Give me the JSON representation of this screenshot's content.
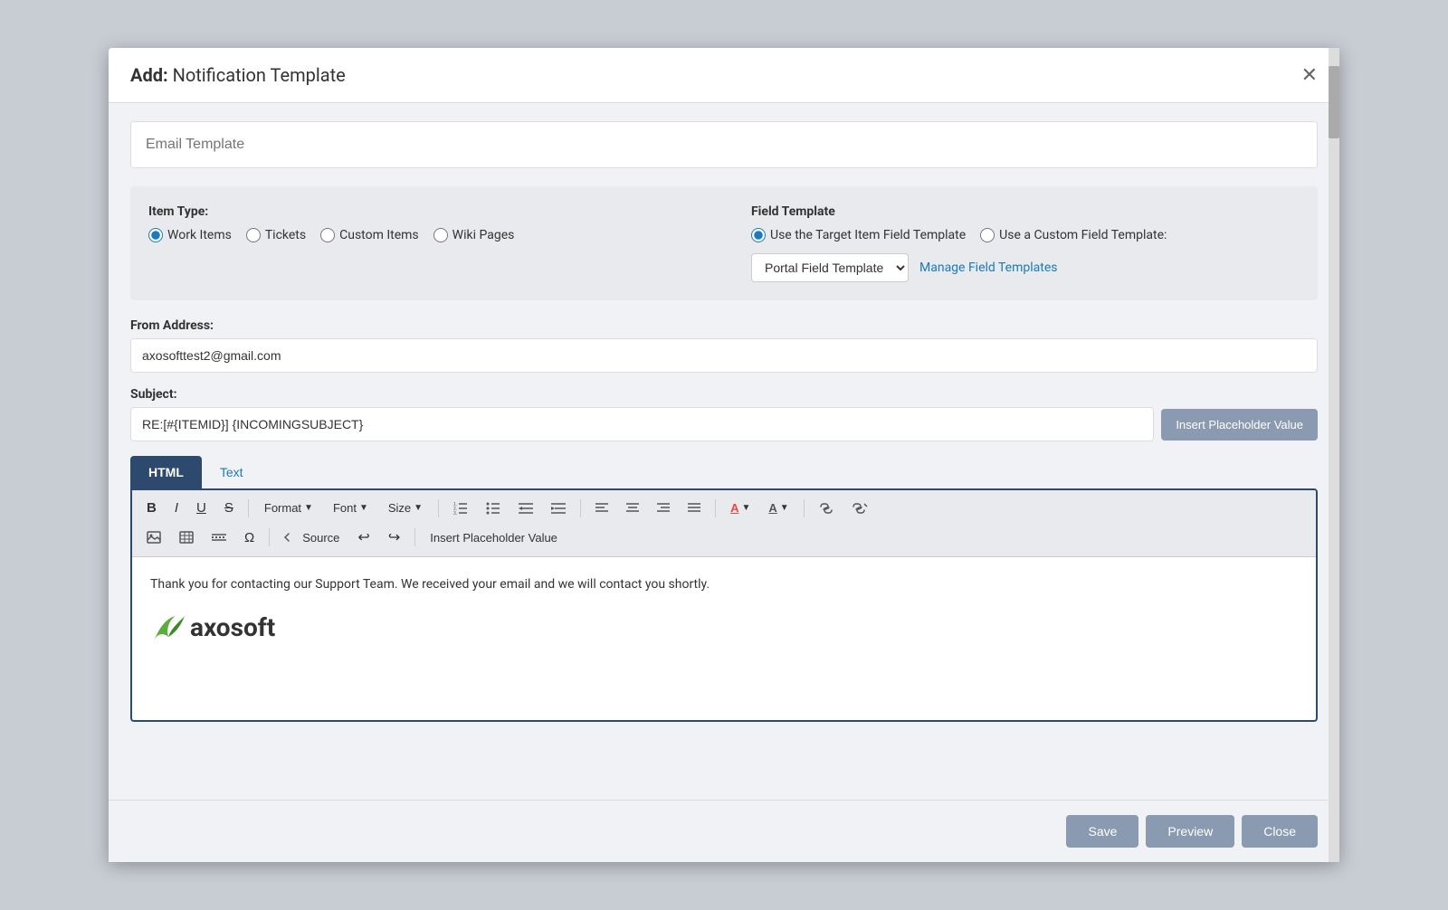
{
  "modal": {
    "title_prefix": "Add:",
    "title": "Notification Template",
    "close_icon": "✕"
  },
  "email_template": {
    "placeholder": "Email Template"
  },
  "item_type": {
    "label": "Item Type:",
    "options": [
      {
        "id": "work-items",
        "label": "Work Items",
        "checked": true
      },
      {
        "id": "tickets",
        "label": "Tickets",
        "checked": false
      },
      {
        "id": "custom-items",
        "label": "Custom Items",
        "checked": false
      },
      {
        "id": "wiki-pages",
        "label": "Wiki Pages",
        "checked": false
      }
    ]
  },
  "field_template": {
    "label": "Field Template",
    "options": [
      {
        "id": "use-target",
        "label": "Use the Target Item Field Template",
        "checked": true
      },
      {
        "id": "use-custom",
        "label": "Use a Custom Field Template:",
        "checked": false
      }
    ],
    "dropdown_value": "Portal Field Template",
    "manage_link": "Manage Field Templates"
  },
  "from_address": {
    "label": "From Address:",
    "value": "axosofttest2@gmail.com"
  },
  "subject": {
    "label": "Subject:",
    "value": "RE:[#{ITEMID}] {INCOMINGSUBJECT}",
    "insert_btn": "Insert Placeholder Value"
  },
  "editor": {
    "tabs": [
      {
        "id": "html",
        "label": "HTML",
        "active": true
      },
      {
        "id": "text",
        "label": "Text",
        "active": false
      }
    ],
    "toolbar": {
      "bold": "B",
      "italic": "I",
      "underline": "U",
      "strikethrough": "S",
      "format": "Format",
      "font": "Font",
      "size": "Size",
      "source": "Source",
      "insert_placeholder": "Insert Placeholder Value"
    },
    "content": "Thank you for contacting our Support Team. We received your email and we will contact you shortly.",
    "logo_text": "axosoft"
  },
  "footer": {
    "save": "Save",
    "preview": "Preview",
    "close": "Close"
  }
}
